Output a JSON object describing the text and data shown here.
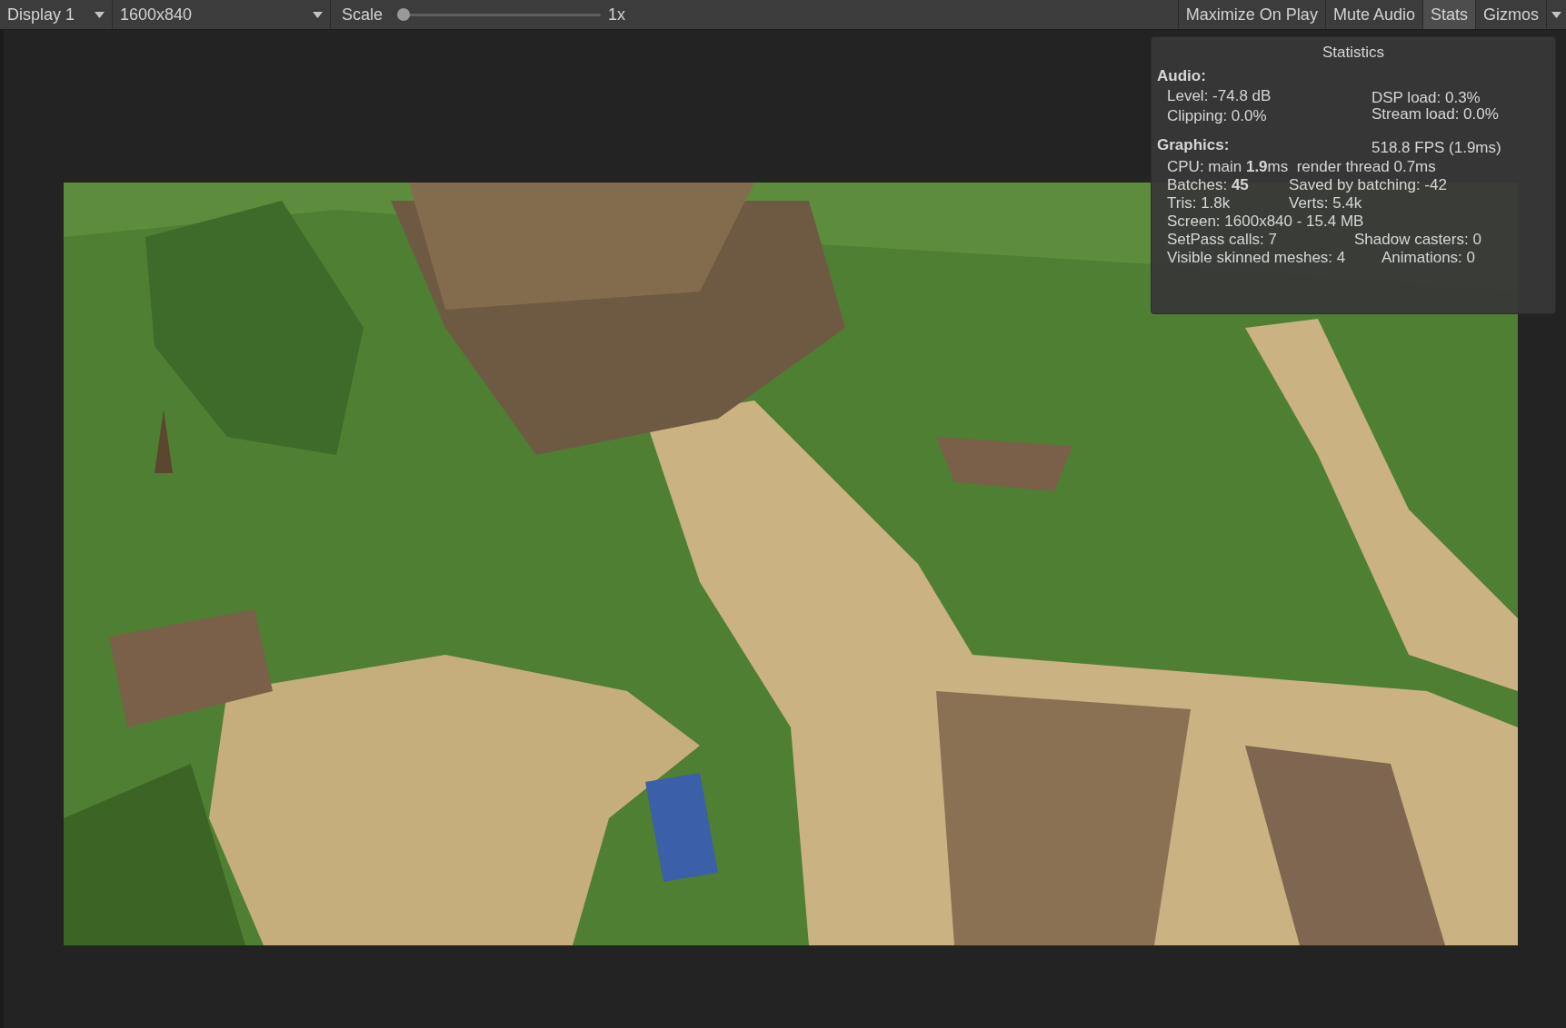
{
  "toolbar": {
    "display": "Display 1",
    "resolution": "1600x840",
    "scale": {
      "label": "Scale",
      "level": 0,
      "reading": "1x"
    },
    "toggles": [
      {
        "label": "Maximize On Play",
        "selected": false
      },
      {
        "label": "Mute Audio",
        "selected": false
      },
      {
        "label": "Stats",
        "selected": true
      },
      {
        "label": "Gizmos",
        "selected": false
      }
    ]
  },
  "statistics": {
    "title": "Statistics",
    "audio": {
      "heading": "Audio:",
      "left": [
        "Level: -74.8 dB",
        "Clipping: 0.0%"
      ],
      "right": [
        "DSP load: 0.3%",
        "Stream load: 0.0%"
      ]
    },
    "graphics": {
      "heading": "Graphics:",
      "fps": "518.8 FPS (1.9ms)",
      "rows": [
        [
          "CPU: main **1.9**ms  render thread 0.7ms"
        ],
        [
          "Batches: **45**",
          "Saved by batching: -42"
        ],
        [
          "Tris: 1.8k",
          "Verts: 5.4k"
        ],
        [
          "Screen: 1600x840 - 15.4 MB"
        ],
        [
          "SetPass calls: 7",
          "Shadow casters: 0"
        ],
        [
          "Visible skinned meshes: 4",
          "Animations: 0"
        ]
      ]
    }
  }
}
